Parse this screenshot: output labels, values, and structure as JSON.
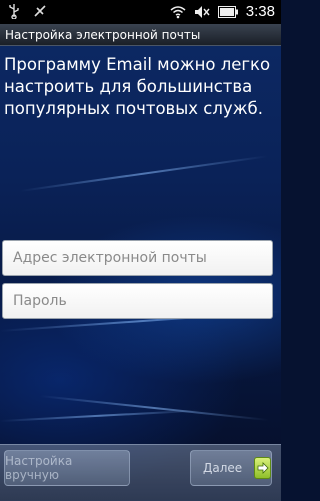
{
  "status_bar": {
    "time": "3:38",
    "icons": [
      "usb-icon",
      "debug-icon",
      "wifi-icon",
      "mute-icon",
      "battery-icon"
    ]
  },
  "title_bar": {
    "title": "Настройка электронной почты"
  },
  "intro_text": "Программу Email можно легко настроить для большинства популярных почтовых служб.",
  "form": {
    "email_placeholder": "Адрес электронной почты",
    "email_value": "",
    "password_placeholder": "Пароль",
    "password_value": ""
  },
  "buttons": {
    "manual_label": "Настройка вручную",
    "next_label": "Далее"
  },
  "colors": {
    "background_dark": "#061230",
    "background_mid": "#0d2a66",
    "next_arrow": "#8fbf2a"
  }
}
